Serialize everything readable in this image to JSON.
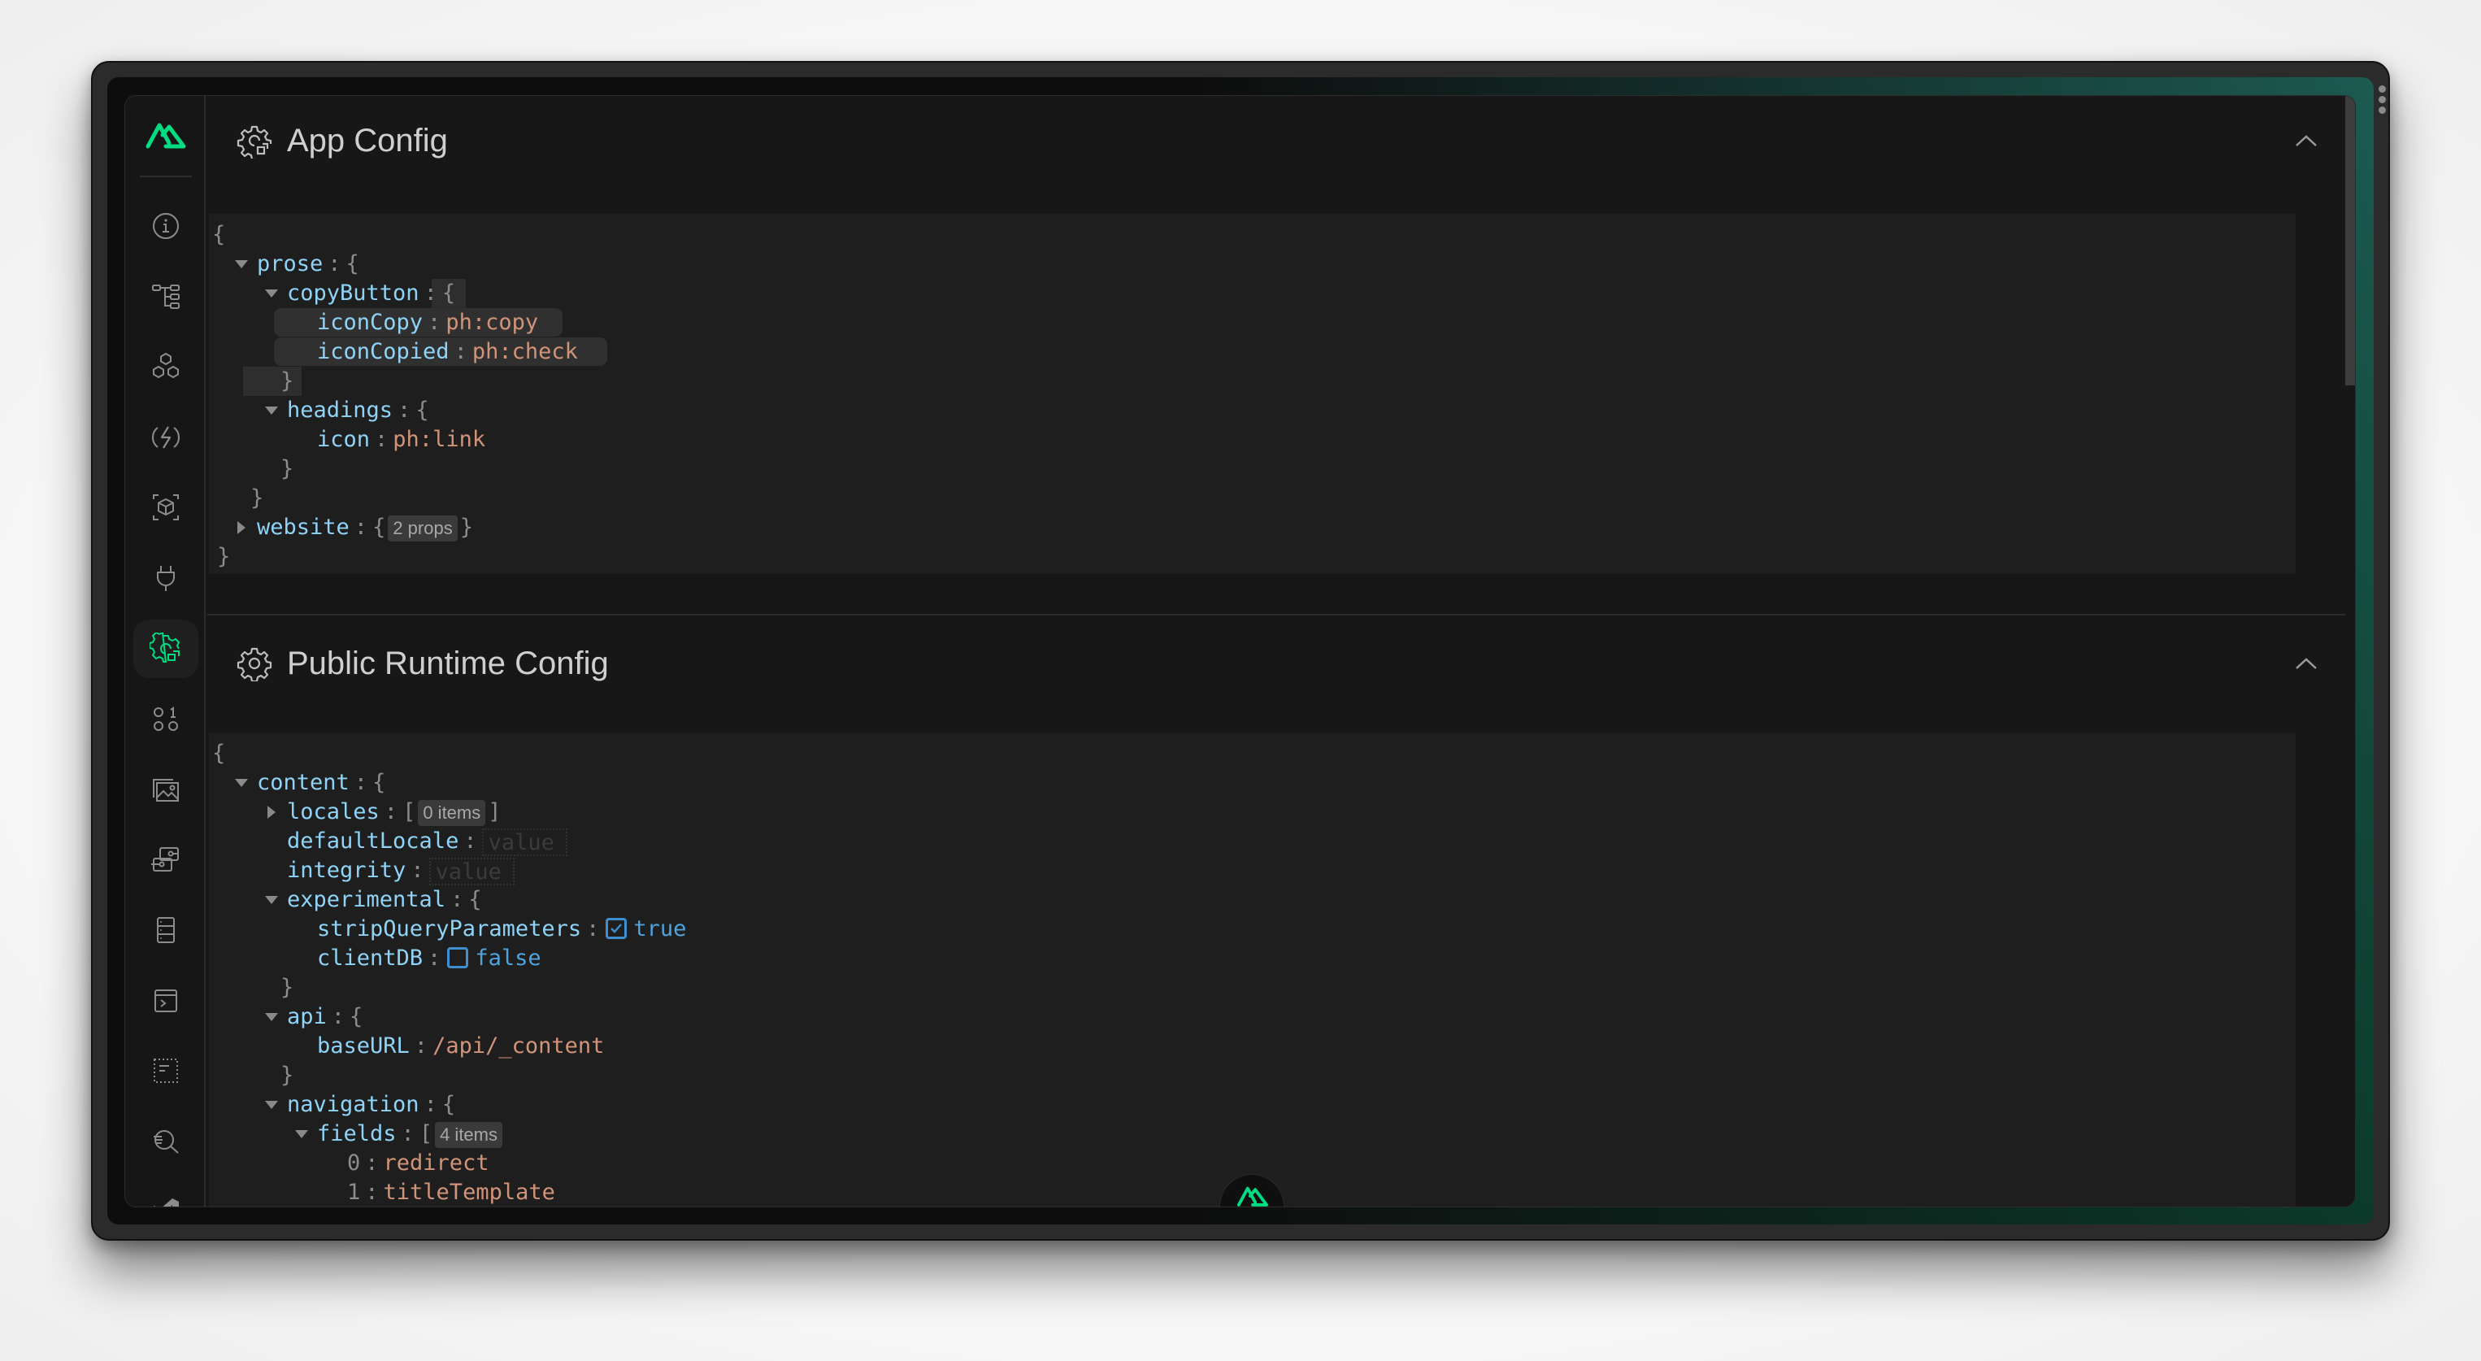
{
  "colors": {
    "accent": "#00dc82",
    "key": "#8fd3f7",
    "string": "#d19478",
    "boolean": "#4fa3dd",
    "panel_bg": "#171717",
    "json_bg": "#1e1e1e"
  },
  "sidebar": {
    "logo": "nuxt-logo",
    "items": [
      {
        "icon": "info-icon",
        "label": "Overview",
        "active": false
      },
      {
        "icon": "tree-icon",
        "label": "Pages",
        "active": false
      },
      {
        "icon": "components-icon",
        "label": "Components",
        "active": false
      },
      {
        "icon": "imports-icon",
        "label": "Imports",
        "active": false
      },
      {
        "icon": "modules-icon",
        "label": "Modules",
        "active": false
      },
      {
        "icon": "plug-icon",
        "label": "Plugins",
        "active": false
      },
      {
        "icon": "runtime-config-icon",
        "label": "Runtime Configs",
        "active": true
      },
      {
        "icon": "payload-icon",
        "label": "Payload",
        "active": false
      },
      {
        "icon": "assets-icon",
        "label": "Assets",
        "active": false
      },
      {
        "icon": "server-routes-icon",
        "label": "Server Routes",
        "active": false
      },
      {
        "icon": "storage-icon",
        "label": "Storage",
        "active": false
      },
      {
        "icon": "terminal-icon",
        "label": "Terminals",
        "active": false
      },
      {
        "icon": "virtual-files-icon",
        "label": "Virtual Files",
        "active": false
      },
      {
        "icon": "inspect-icon",
        "label": "Inspect",
        "active": false
      },
      {
        "icon": "vscode-icon",
        "label": "VS Code",
        "active": false
      }
    ]
  },
  "sections": [
    {
      "title": "App Config",
      "icon": "app-config-gear-icon",
      "collapse_icon": "chevron-up-icon",
      "lines": [
        {
          "depth": 0,
          "type": "open",
          "text": "{"
        },
        {
          "depth": 1,
          "type": "expanded",
          "key": "prose",
          "open": "{"
        },
        {
          "depth": 2,
          "type": "expanded",
          "key": "copyButton",
          "open": "{"
        },
        {
          "depth": 3,
          "type": "string",
          "key": "iconCopy",
          "value": "ph:copy"
        },
        {
          "depth": 3,
          "type": "string",
          "key": "iconCopied",
          "value": "ph:check"
        },
        {
          "depth": 2,
          "type": "close",
          "text": "}"
        },
        {
          "depth": 2,
          "type": "expanded",
          "key": "headings",
          "open": "{"
        },
        {
          "depth": 3,
          "type": "string",
          "key": "icon",
          "value": "ph:link"
        },
        {
          "depth": 2,
          "type": "close",
          "text": "}"
        },
        {
          "depth": 1,
          "type": "close",
          "text": "}"
        },
        {
          "depth": 1,
          "type": "collapsed",
          "key": "website",
          "open": "{",
          "badge": "2 props",
          "close": "}"
        },
        {
          "depth": 0,
          "type": "close",
          "text": "}"
        }
      ]
    },
    {
      "title": "Public Runtime Config",
      "icon": "gear-icon",
      "collapse_icon": "chevron-up-icon",
      "lines": [
        {
          "depth": 0,
          "type": "open",
          "text": "{"
        },
        {
          "depth": 1,
          "type": "expanded",
          "key": "content",
          "open": "{"
        },
        {
          "depth": 2,
          "type": "collapsed",
          "key": "locales",
          "open": "[",
          "badge": "0 items",
          "close": "]"
        },
        {
          "depth": 2,
          "type": "empty",
          "key": "defaultLocale",
          "placeholder": "value"
        },
        {
          "depth": 2,
          "type": "empty",
          "key": "integrity",
          "placeholder": "value"
        },
        {
          "depth": 2,
          "type": "expanded",
          "key": "experimental",
          "open": "{"
        },
        {
          "depth": 3,
          "type": "boolean",
          "key": "stripQueryParameters",
          "checked": true,
          "value": "true"
        },
        {
          "depth": 3,
          "type": "boolean",
          "key": "clientDB",
          "checked": false,
          "value": "false"
        },
        {
          "depth": 2,
          "type": "close",
          "text": "}"
        },
        {
          "depth": 2,
          "type": "expanded",
          "key": "api",
          "open": "{"
        },
        {
          "depth": 3,
          "type": "string",
          "key": "baseURL",
          "value": "/api/_content"
        },
        {
          "depth": 2,
          "type": "close",
          "text": "}"
        },
        {
          "depth": 2,
          "type": "expanded",
          "key": "navigation",
          "open": "{"
        },
        {
          "depth": 3,
          "type": "expanded-array",
          "key": "fields",
          "open": "[",
          "badge": "4 items"
        },
        {
          "depth": 4,
          "type": "index",
          "key": "0",
          "value": "redirect"
        },
        {
          "depth": 4,
          "type": "index",
          "key": "1",
          "value": "titleTemplate"
        }
      ]
    }
  ],
  "bottom_badge": {
    "icon": "nuxt-logo"
  }
}
